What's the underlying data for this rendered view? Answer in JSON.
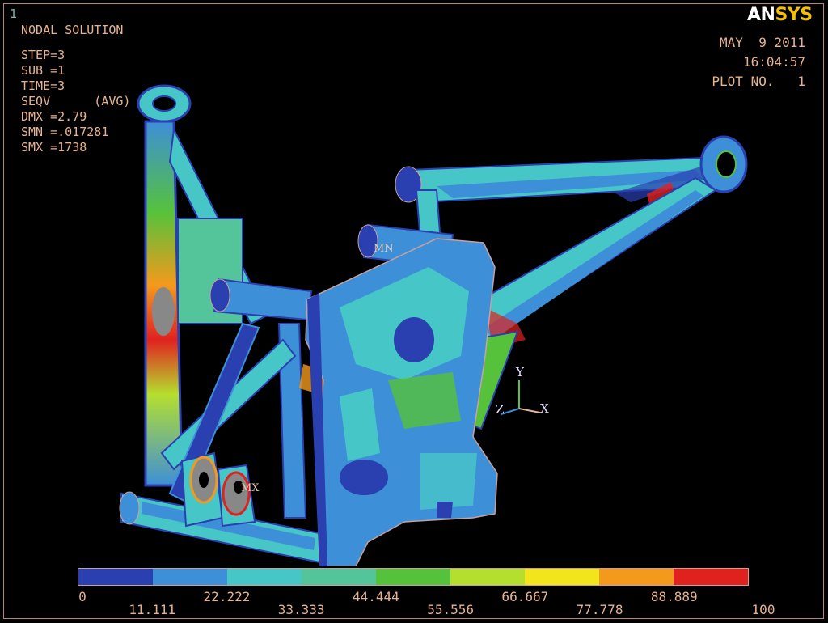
{
  "window_number": "1",
  "info": {
    "title": "NODAL SOLUTION",
    "lines": [
      "STEP=3",
      "SUB =1",
      "TIME=3",
      "SEQV      (AVG)",
      "DMX =2.79",
      "SMN =.017281",
      "SMX =1738"
    ]
  },
  "logo": {
    "part1": "AN",
    "part2": "SYS"
  },
  "stamp": {
    "date": "MAY  9 2011",
    "time": "16:04:57",
    "plot": "PLOT NO.   1"
  },
  "markers": {
    "min": "MN",
    "max": "MX"
  },
  "axes": {
    "y": "Y",
    "z": "Z",
    "x": "X"
  },
  "legend": {
    "colors": [
      "#2a3fb0",
      "#3d8fd8",
      "#47c6c8",
      "#54c59a",
      "#56c23b",
      "#b5df2e",
      "#f2e51c",
      "#f39a1d",
      "#e0221f"
    ],
    "ticks": [
      "0",
      "11.111",
      "22.222",
      "33.333",
      "44.444",
      "55.556",
      "66.667",
      "77.778",
      "88.889",
      "100"
    ]
  }
}
